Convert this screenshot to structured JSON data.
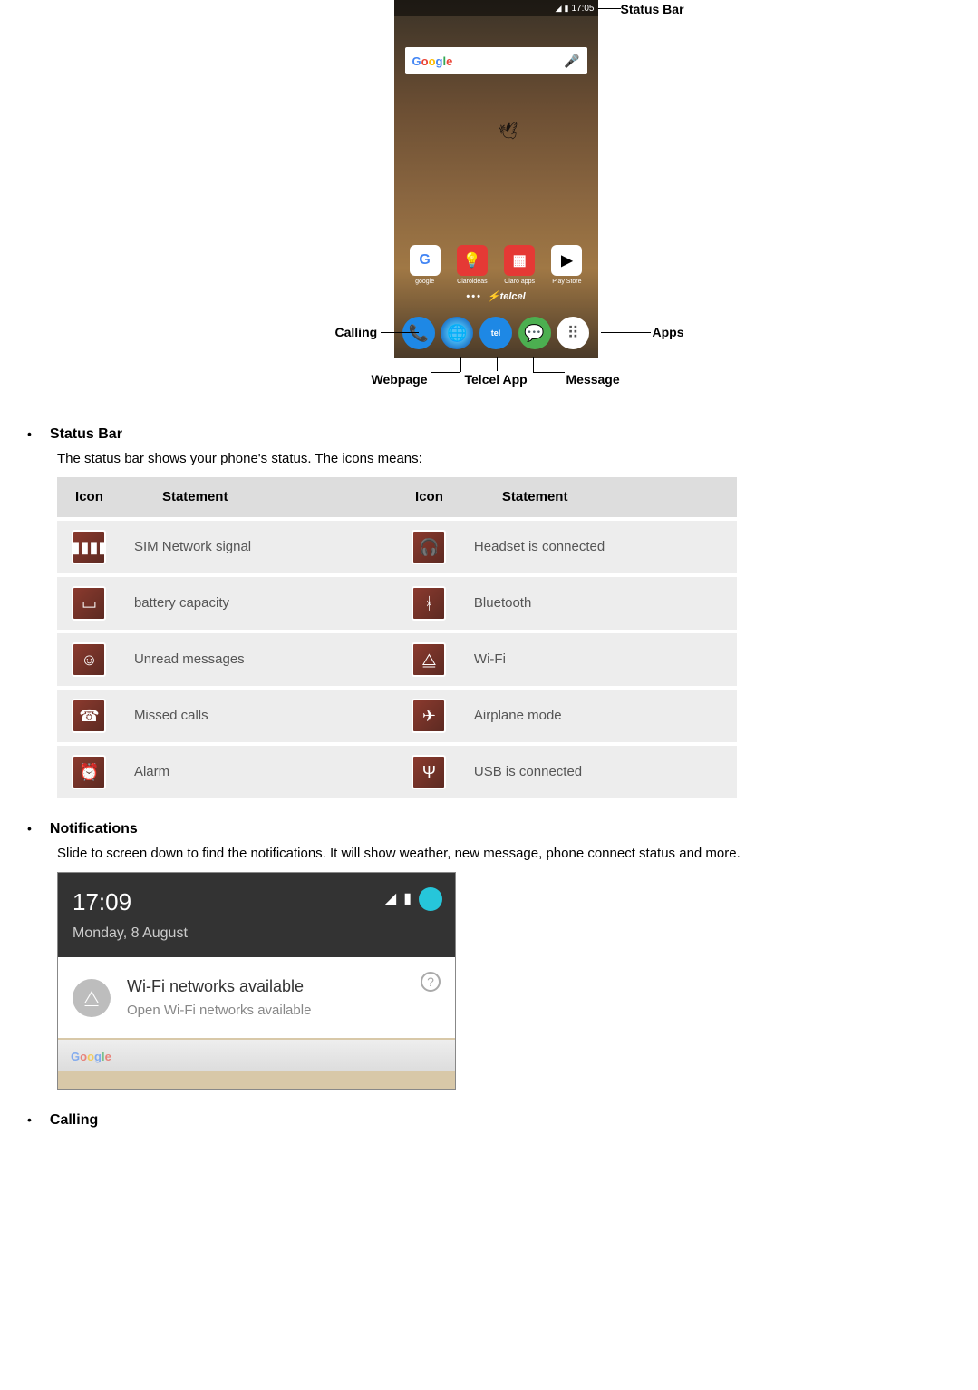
{
  "phone": {
    "status_time": "17:05",
    "search_placeholder": "Google",
    "app_icons": [
      {
        "label": "google"
      },
      {
        "label": "Claroideas"
      },
      {
        "label": "Claro apps"
      },
      {
        "label": "Play Store"
      }
    ],
    "brand": "telcel",
    "dock_icons": [
      "phone",
      "globe",
      "telcel",
      "message",
      "apps"
    ]
  },
  "callouts": {
    "status": "Status Bar",
    "apps": "Apps",
    "calling": "Calling",
    "webpage": "Webpage",
    "telcel_app": "Telcel App",
    "message": "Message"
  },
  "sections": {
    "status_bar": {
      "title": "Status Bar",
      "body": "The status bar shows your phone's status. The icons means:",
      "table": {
        "headers": {
          "c1": "Icon",
          "c2": "Statement",
          "c3": "Icon",
          "c4": "Statement"
        },
        "rows": [
          {
            "i1": "signal-icon",
            "s1": "SIM Network signal",
            "i2": "headset-icon",
            "s2": "Headset is connected"
          },
          {
            "i1": "battery-icon",
            "s1": "battery capacity",
            "i2": "bluetooth-icon",
            "s2": "Bluetooth"
          },
          {
            "i1": "message-icon",
            "s1": "Unread messages",
            "i2": "wifi-icon",
            "s2": "Wi-Fi"
          },
          {
            "i1": "missed-call-icon",
            "s1": "Missed calls",
            "i2": "airplane-icon",
            "s2": "Airplane mode"
          },
          {
            "i1": "alarm-icon",
            "s1": "Alarm",
            "i2": "usb-icon",
            "s2": "USB is connected"
          }
        ]
      }
    },
    "notifications": {
      "title": "Notifications",
      "body": "Slide to screen down to find the notifications. It will show weather, new message, phone connect status and more.",
      "panel": {
        "time": "17:09",
        "date": "Monday, 8 August",
        "card_title": "Wi-Fi networks available",
        "card_sub": "Open Wi-Fi networks available"
      }
    },
    "calling": {
      "title": "Calling"
    }
  },
  "icon_glyphs": {
    "signal-icon": "▮▮▮▮",
    "headset-icon": "🎧",
    "battery-icon": "▭",
    "bluetooth-icon": "ᚼ",
    "message-icon": "☺",
    "wifi-icon": "⧋",
    "missed-call-icon": "☎",
    "airplane-icon": "✈",
    "alarm-icon": "⏰",
    "usb-icon": "Ψ"
  }
}
